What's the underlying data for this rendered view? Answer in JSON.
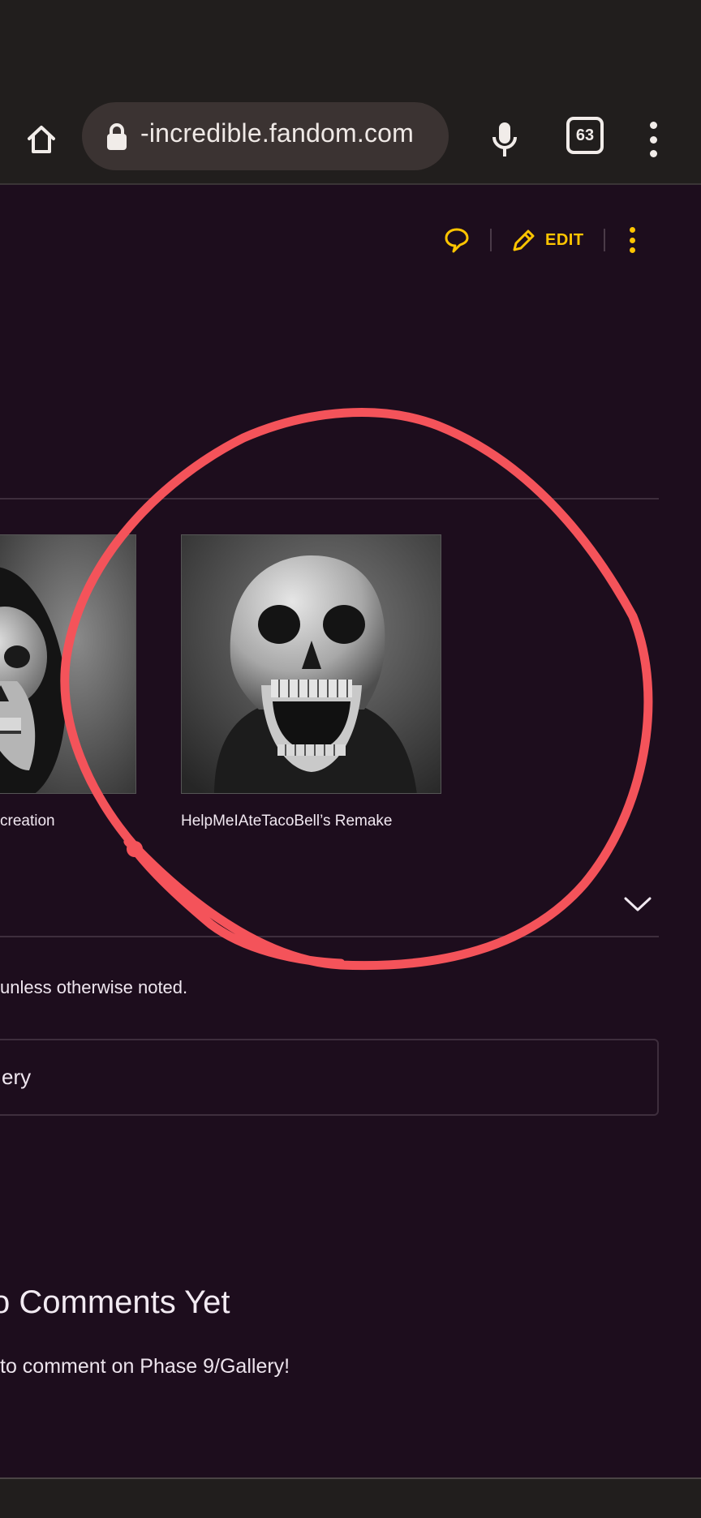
{
  "browser": {
    "url": "-incredible.fandom.com",
    "tab_count": "63",
    "icons": {
      "home": "home-icon",
      "lock": "lock-icon",
      "mic": "microphone-icon",
      "tabs": "tab-switcher-icon",
      "menu": "overflow-menu-icon"
    }
  },
  "page_actions": {
    "edit_label": "EDIT",
    "accent_color": "#ffc500"
  },
  "gallery": {
    "items": [
      {
        "caption": "creation"
      },
      {
        "caption": "HelpMeIAteTacoBell’s Remake"
      }
    ]
  },
  "license_text": "unless otherwise noted.",
  "category_text": "ery",
  "comments": {
    "title": "o Comments Yet",
    "subtitle": "to comment on Phase 9/Gallery!"
  },
  "colors": {
    "page_background": "#1d0d1d",
    "browser_chrome": "#211e1d",
    "annotation_stroke": "#f4535a"
  }
}
